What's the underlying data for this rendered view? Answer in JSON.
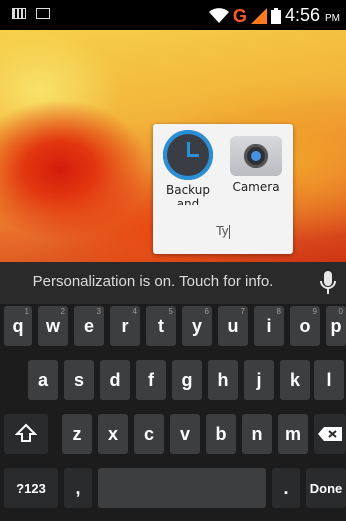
{
  "status_bar": {
    "network_label": "G",
    "time": "4:56",
    "ampm": "PM",
    "icons": [
      "keyboard-icon",
      "image-icon",
      "wifi-icon",
      "signal-icon",
      "battery-icon"
    ]
  },
  "folder": {
    "apps": [
      {
        "label_line1": "Backup",
        "label_line2": "and",
        "icon": "backup-icon"
      },
      {
        "label_line1": "Camera",
        "label_line2": "",
        "icon": "camera-icon"
      }
    ],
    "name_value": "Ty"
  },
  "keyboard": {
    "suggestion": "Personalization is on. Touch for info.",
    "row1": [
      {
        "label": "q",
        "hint": "1"
      },
      {
        "label": "w",
        "hint": "2"
      },
      {
        "label": "e",
        "hint": "3"
      },
      {
        "label": "r",
        "hint": "4"
      },
      {
        "label": "t",
        "hint": "5"
      },
      {
        "label": "y",
        "hint": "6"
      },
      {
        "label": "u",
        "hint": "7"
      },
      {
        "label": "i",
        "hint": "8"
      },
      {
        "label": "o",
        "hint": "9"
      },
      {
        "label": "p",
        "hint": "0"
      }
    ],
    "row2": [
      "a",
      "s",
      "d",
      "f",
      "g",
      "h",
      "j",
      "k",
      "l"
    ],
    "row3": [
      "z",
      "x",
      "c",
      "v",
      "b",
      "n",
      "m"
    ],
    "symbols_label": "?123",
    "comma_label": ",",
    "period_label": ".",
    "done_label": "Done"
  }
}
